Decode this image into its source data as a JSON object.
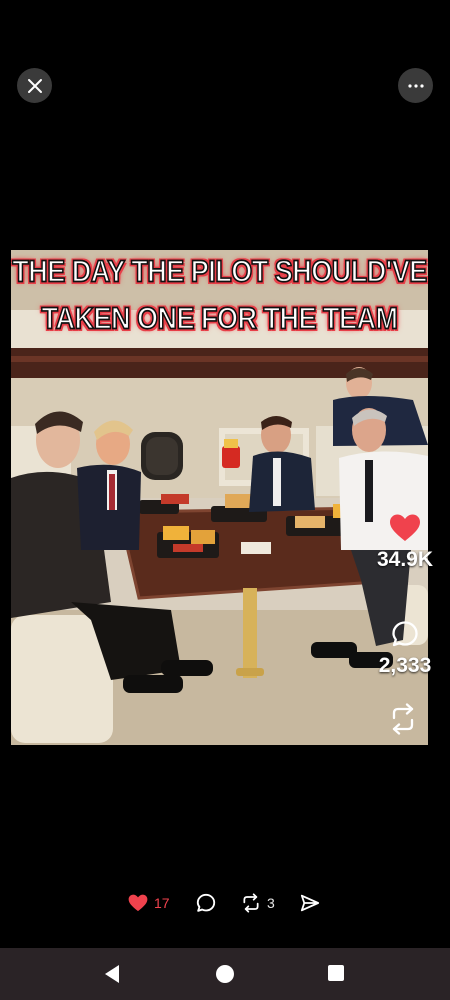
{
  "top_bar": {
    "close_icon": "close-icon",
    "more_icon": "more-horizontal-icon"
  },
  "post": {
    "image_caption_line1": "THE DAY THE PILOT SHOULD'VE",
    "image_caption_line2": "TAKEN ONE FOR THE TEAM",
    "likes_count": "34.9K",
    "comments_count": "2,333"
  },
  "actions": {
    "like_count": "17",
    "repost_count": "3"
  },
  "colors": {
    "heart": "#f0424d",
    "background": "#000000",
    "nav_bar": "#2a2326",
    "caption_glow": "#e8404a"
  },
  "nav": {
    "back_icon": "back-triangle-icon",
    "home_icon": "home-circle-icon",
    "recents_icon": "recents-square-icon"
  }
}
